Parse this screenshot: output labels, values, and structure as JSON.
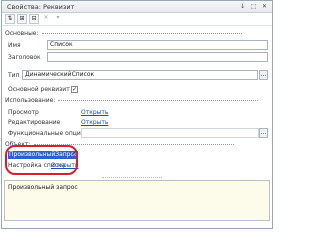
{
  "window": {
    "title": "Свойства: Реквизит"
  },
  "titlebar": {
    "buttons": [
      "↓",
      "⬚",
      "✕"
    ]
  },
  "toolbar": {
    "buttons": [
      "⇅",
      "⊞",
      "⊟",
      "✕",
      "▾"
    ]
  },
  "groups": {
    "basic": "Основные:",
    "usage": "Использование:",
    "object": "Объект:"
  },
  "fields": {
    "name_label": "Имя",
    "name_value": "Список",
    "header_label": "Заголовок",
    "header_value": "",
    "type_label": "Тип",
    "type_value": "ДинамическийСписок",
    "main_attr_label": "Основной реквизит",
    "main_attr_checked": "✓",
    "view_label": "Просмотр",
    "view_link": "Открыть",
    "edit_label": "Редактирование",
    "edit_link": "Открыть",
    "func_label": "Функциональные опции",
    "func_value": "",
    "arbitrary_query_label": "ПроизвольныйЗапрос",
    "arbitrary_query_checked": "✓",
    "list_settings_label": "Настройка списка",
    "list_settings_link": "Открыть"
  },
  "description": "Произвольный запрос"
}
